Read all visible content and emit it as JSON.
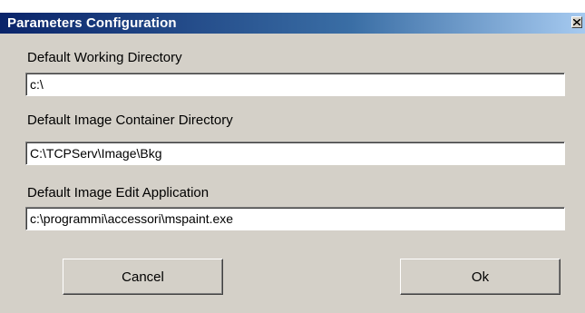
{
  "window": {
    "title": "Parameters Configuration",
    "close_icon": "close-icon"
  },
  "fields": [
    {
      "label": "Default Working Directory",
      "value": "c:\\"
    },
    {
      "label": "Default Image Container Directory",
      "value": "C:\\TCPServ\\Image\\Bkg"
    },
    {
      "label": "Default Image Edit Application",
      "value": "c:\\programmi\\accessori\\mspaint.exe"
    }
  ],
  "buttons": {
    "cancel_label": "Cancel",
    "ok_label": "Ok"
  },
  "colors": {
    "dialog_background": "#d4d0c8",
    "titlebar_start": "#0a246a",
    "titlebar_end": "#a6caf0"
  }
}
